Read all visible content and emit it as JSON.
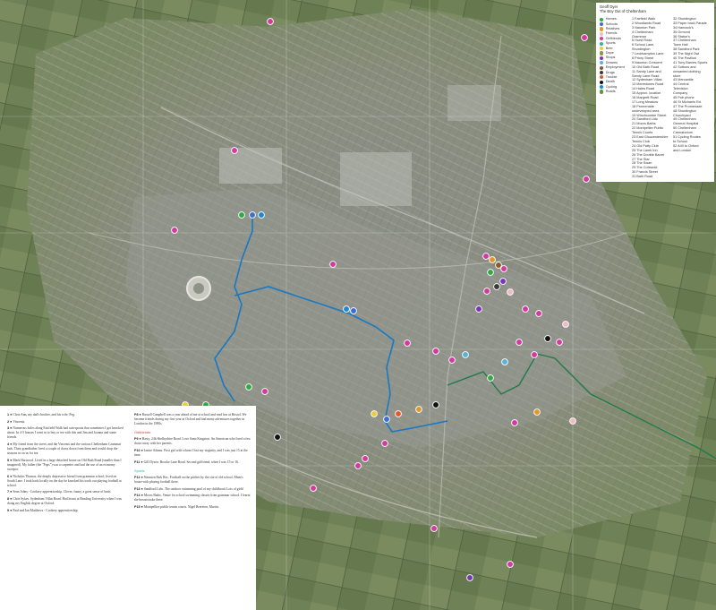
{
  "legend": {
    "title_line1": "Geoff Dyer",
    "title_line2": "The Boy Out of Cheltenham",
    "categories": [
      {
        "label": "Homes",
        "color": "#2fa845"
      },
      {
        "label": "Schools",
        "color": "#3a6fd0"
      },
      {
        "label": "Relatives",
        "color": "#e0972b"
      },
      {
        "label": "Friends",
        "color": "#f0b8c8"
      },
      {
        "label": "Girlfriends",
        "color": "#d23aa0"
      },
      {
        "label": "Sports",
        "color": "#2fb3a3"
      },
      {
        "label": "Beer",
        "color": "#f0c93a"
      },
      {
        "label": "Dope",
        "color": "#9a8f4a"
      },
      {
        "label": "Shops",
        "color": "#7a35b5"
      },
      {
        "label": "Dreams",
        "color": "#5bb0d8"
      },
      {
        "label": "Employment",
        "color": "#8a5a2a"
      },
      {
        "label": "Drugs",
        "color": "#3a3a3a"
      },
      {
        "label": "Trouble",
        "color": "#e05a2b"
      },
      {
        "label": "Death",
        "color": "#111111"
      },
      {
        "label": "Cycling",
        "color": "#1a8ad0"
      },
      {
        "label": "Roads",
        "color": "#5a9a3a"
      }
    ],
    "locations_a": [
      "1 Fairfield Walk",
      "2 Woodlands Road",
      "3 Naunton Park",
      "4 Cheltenham",
      "  Grammar",
      "5 Hurst Road",
      "6 School Lane,",
      "  Shurdington",
      "7 Leckhampton Lane",
      "8 Priory Street",
      "9 Naunton Crescent",
      "10 Old Bath Road",
      "11 Sandy Lane and",
      "  Sandy Lane Road",
      "12 Sydenham Villas",
      "13 Merestones Road",
      "14 Hales Road",
      "15 Approx. location",
      "16 Margrett Road",
      "17 Long Meadow",
      "18 Promenade",
      "  undeveloped area",
      "19 Winchcombe Street",
      "20 Sandford Lido",
      "21 Moors Baths",
      "22 Montpellier Public",
      "  Tennis Courts",
      "23 East Gloucestershire",
      "  Tennis Club",
      "24 Old Patty Club",
      "25 The Lamb Inn",
      "26 The Double Barrel",
      "27 The Star",
      "28 The Swan",
      "29 The Cotswold",
      "30 Francis Street",
      "31 Bath Road"
    ],
    "locations_b": [
      "32 Shurdington",
      "33 Paper back Parade",
      "34 Hancock's",
      "35 Ormond",
      "36 Statue's",
      "37 Cheltenham",
      "  Town Hall",
      "38 Sandford Park",
      "39 The Night Owl",
      "40 The Pavilion",
      "41 Tony Barnes Sports",
      "42 Suttons and",
      "  unwanted clothing",
      "  store",
      "43 Mercantile",
      "44 Central",
      "  Television",
      "  Company",
      "45 Pub phone",
      "46 St Michaels Rd.",
      "47 The Promenade",
      "48 Shurdington",
      "  Churchyard",
      "49 Cheltenham",
      "  General Hospital",
      "50 Cheltenham",
      "  Crematorium",
      "51 Cycling Routes",
      "  to School",
      "52 A40 to Oxford",
      "  and London"
    ]
  },
  "text_panel": {
    "col1": [
      {
        "n": "1 ●",
        "text": "Chris Ann, my dad's brother, and his wife, Peg."
      },
      {
        "n": "2 ●",
        "text": "Vincents."
      },
      {
        "n": "3 ●",
        "text": "Numerous holes along Fairfield Walk had rain-spouts that sometimes I got knocked about. In 4-5 houses I went in to buy or tea with this and Jim and Joanna and some friends."
      },
      {
        "n": "4 ●",
        "text": "My friend from the street, and the Vincents and the various Cheltenham Grammar lads. Their grandfather lived a couple of doors down from them and would drop the seasons in on us for tea."
      },
      {
        "n": "5 ●",
        "text": "Mark Harwood. Lived in a large detached house on Old Bath Road (smaller than I imagined). My father (the \"Pops\") was a carpenter and had the use of an economy sweeper."
      },
      {
        "n": "6 ●",
        "text": "Nicholas Thomas, the deeply depressive friend from grammar school, lived on South Lane. I took back locally on the day he knocked his tooth out playing football at school."
      },
      {
        "n": "7 ●",
        "text": "Sean Johns - Cookery apprenticeship. Clever, funny, a great sense of bush."
      },
      {
        "n": "8 ●",
        "text": "Chris Sykes. Sydenham Villas Road. Had learnt at Reading University when I was doing my English degree at Oxford."
      },
      {
        "n": "9 ●",
        "text": "Paul and Ian Matthews - Cookery apprenticeship."
      }
    ],
    "col2": [
      {
        "n": "P8 ●",
        "text": "Russell Campbell was a year ahead of me at school and read law at Bristol. We became friends during my first year at Oxford and had many adventures together in London in the 1980s."
      },
      {
        "n": "",
        "text": "Girlfriends"
      },
      {
        "n": "P9 ●",
        "text": "Hasty, 24b Shelbyshire Road. Love Sami Kingston. An American who lived a few doors away with her parents."
      },
      {
        "n": "P10 ●",
        "text": "Janice Adams. First girl with whom I lost my virginity, and I was just 15 at the time."
      },
      {
        "n": "P11 ●",
        "text": "Gill Dyson. Brooke Lane Road. Second girlfriend, when I was 15 or 16."
      },
      {
        "n": "",
        "text": "Sports"
      },
      {
        "n": "P12 ●",
        "text": "Naunton Park Rec. Football on the pitches by the site of old school. Mum's house with playing football there."
      },
      {
        "n": "P13 ●",
        "text": "Sandford Lido. The outdoor swimming pool of my childhood. Lots of girls!"
      },
      {
        "n": "P14 ●",
        "text": "Moors Baths. Venue for school swimming classes from grammar school. I learnt the breaststroke there."
      },
      {
        "n": "P15 ●",
        "text": "Montpellier public tennis courts. Nigel Brereton, Martin."
      }
    ],
    "sect_titles": [
      "Girlfriends",
      "Sports"
    ]
  }
}
